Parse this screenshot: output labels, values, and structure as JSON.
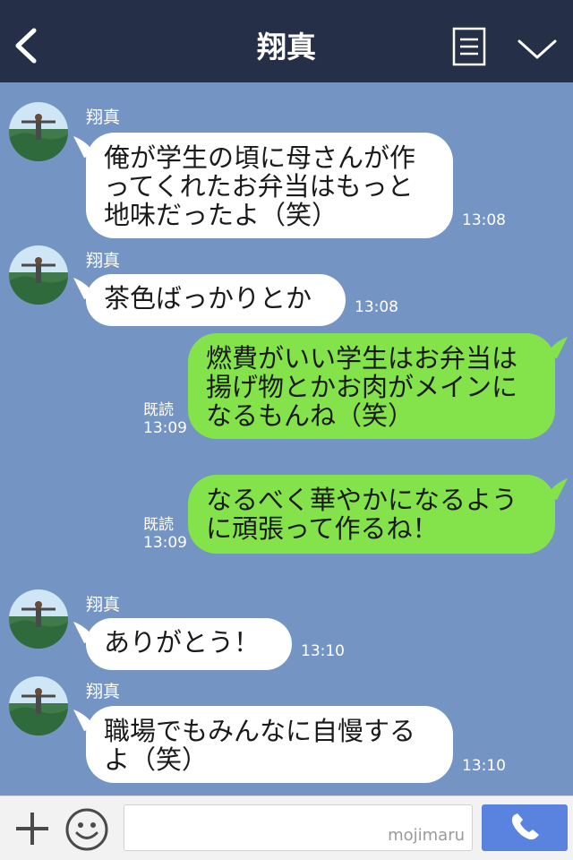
{
  "header": {
    "back_icon": "chevron-left-icon",
    "title": "翔真",
    "menu_icon": "note-list-icon",
    "collapse_icon": "chevron-down-icon",
    "background": "#253048"
  },
  "chat": {
    "background": "#7494c4",
    "incoming_bubble_color": "#ffffff",
    "outgoing_bubble_color": "#84e24a",
    "messages": [
      {
        "direction": "incoming",
        "sender": "翔真",
        "text": "俺が学生の頃に母さんが作\nってくれたお弁当はもっと\n地味だったよ（笑）",
        "time": "13:08"
      },
      {
        "direction": "incoming",
        "sender": "翔真",
        "text": "茶色ばっかりとか",
        "time": "13:08"
      },
      {
        "direction": "outgoing",
        "text": "燃費がいい学生はお弁当は\n揚げ物とかお肉がメインに\nなるもんね（笑）",
        "read": "既読",
        "time": "13:09"
      },
      {
        "direction": "outgoing",
        "text": "なるべく華やかになるよう\nに頑張って作るね！",
        "read": "既読",
        "time": "13:09"
      },
      {
        "direction": "incoming",
        "sender": "翔真",
        "text": "ありがとう！",
        "time": "13:10"
      },
      {
        "direction": "incoming",
        "sender": "翔真",
        "text": "職場でもみんなに自慢する\nよ（笑）",
        "time": "13:10"
      }
    ]
  },
  "footer": {
    "plus_icon": "plus-icon",
    "emoji_icon": "smiley-icon",
    "input_value": "",
    "watermark": "mojimaru",
    "call_icon": "phone-icon",
    "call_button_color": "#5a83e0"
  }
}
